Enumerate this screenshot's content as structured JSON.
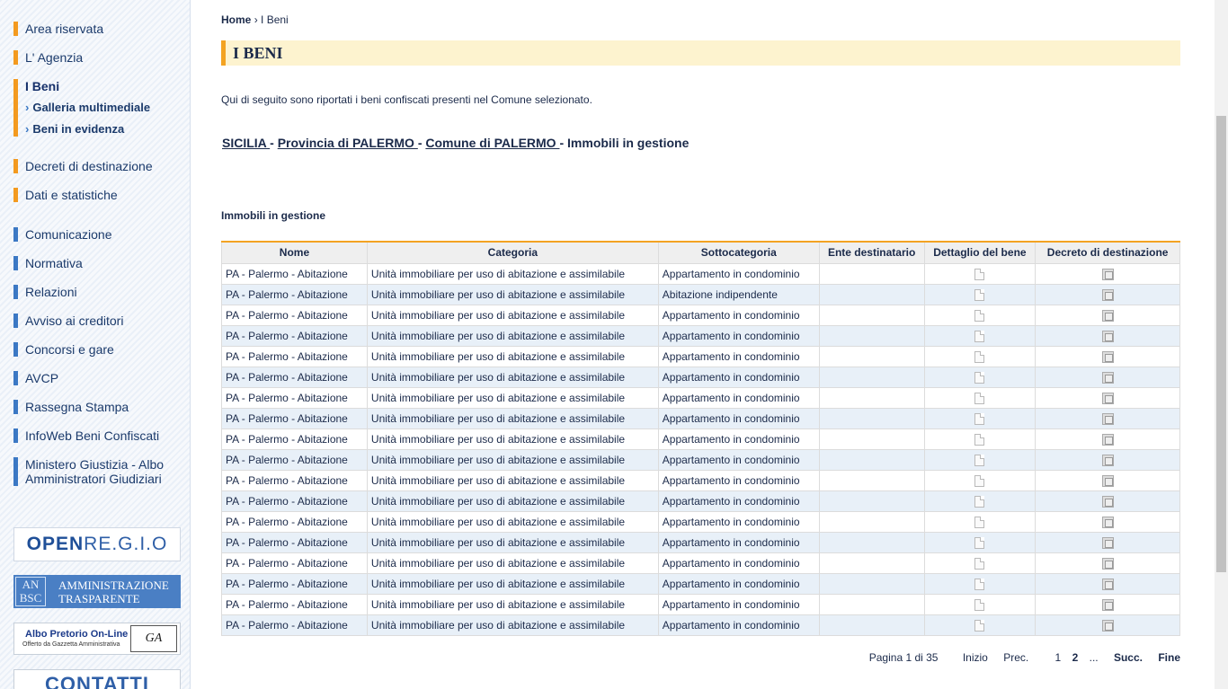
{
  "sidebar": {
    "items": [
      {
        "label": "Area riservata"
      },
      {
        "label": "L' Agenzia"
      },
      {
        "label": "I Beni",
        "subitems": [
          "Galleria multimediale",
          "Beni in evidenza"
        ]
      },
      {
        "label": "Decreti di destinazione"
      },
      {
        "label": "Dati e statistiche"
      },
      {
        "label": "Comunicazione"
      },
      {
        "label": "Normativa"
      },
      {
        "label": "Relazioni"
      },
      {
        "label": "Avviso ai creditori"
      },
      {
        "label": "Concorsi e gare"
      },
      {
        "label": "AVCP"
      },
      {
        "label": "Rassegna Stampa"
      },
      {
        "label": "InfoWeb Beni Confiscati"
      },
      {
        "label": "Ministero Giustizia - Albo Amministratori Giudiziari"
      }
    ],
    "banners": {
      "openregio_a": "OPEN",
      "openregio_b": "RE.G.I.O",
      "anbsc_logo": "AN BSC",
      "anbsc_text": "AMMINISTRAZIONE TRASPARENTE",
      "albo_title": "Albo Pretorio On-Line",
      "albo_sub": "Offerto da Gazzetta Amministrativa",
      "albo_logo": "GA",
      "contatti": "CONTATTI"
    }
  },
  "breadcrumb": {
    "home": "Home",
    "separator": "›",
    "current": "I Beni"
  },
  "page_title": "I BENI",
  "intro": "Qui di seguito sono riportati i beni confiscati presenti nel Comune selezionato.",
  "path": {
    "region": "SICILIA ",
    "province": "Provincia di PALERMO ",
    "comune": "Comune di PALERMO ",
    "sep": " - ",
    "tail": "Immobili in gestione"
  },
  "section_label": "Immobili in gestione",
  "table": {
    "headers": [
      "Nome",
      "Categoria",
      "Sottocategoria",
      "Ente destinatario",
      "Dettaglio del bene",
      "Decreto di destinazione"
    ],
    "rows": [
      [
        "PA - Palermo - Abitazione",
        "Unità immobiliare per uso di abitazione e assimilabile",
        "Appartamento in condominio",
        ""
      ],
      [
        "PA - Palermo - Abitazione",
        "Unità immobiliare per uso di abitazione e assimilabile",
        "Abitazione indipendente",
        ""
      ],
      [
        "PA - Palermo - Abitazione",
        "Unità immobiliare per uso di abitazione e assimilabile",
        "Appartamento in condominio",
        ""
      ],
      [
        "PA - Palermo - Abitazione",
        "Unità immobiliare per uso di abitazione e assimilabile",
        "Appartamento in condominio",
        ""
      ],
      [
        "PA - Palermo - Abitazione",
        "Unità immobiliare per uso di abitazione e assimilabile",
        "Appartamento in condominio",
        ""
      ],
      [
        "PA - Palermo - Abitazione",
        "Unità immobiliare per uso di abitazione e assimilabile",
        "Appartamento in condominio",
        ""
      ],
      [
        "PA - Palermo - Abitazione",
        "Unità immobiliare per uso di abitazione e assimilabile",
        "Appartamento in condominio",
        ""
      ],
      [
        "PA - Palermo - Abitazione",
        "Unità immobiliare per uso di abitazione e assimilabile",
        "Appartamento in condominio",
        ""
      ],
      [
        "PA - Palermo - Abitazione",
        "Unità immobiliare per uso di abitazione e assimilabile",
        "Appartamento in condominio",
        ""
      ],
      [
        "PA - Palermo - Abitazione",
        "Unità immobiliare per uso di abitazione e assimilabile",
        "Appartamento in condominio",
        ""
      ],
      [
        "PA - Palermo - Abitazione",
        "Unità immobiliare per uso di abitazione e assimilabile",
        "Appartamento in condominio",
        ""
      ],
      [
        "PA - Palermo - Abitazione",
        "Unità immobiliare per uso di abitazione e assimilabile",
        "Appartamento in condominio",
        ""
      ],
      [
        "PA - Palermo - Abitazione",
        "Unità immobiliare per uso di abitazione e assimilabile",
        "Appartamento in condominio",
        ""
      ],
      [
        "PA - Palermo - Abitazione",
        "Unità immobiliare per uso di abitazione e assimilabile",
        "Appartamento in condominio",
        ""
      ],
      [
        "PA - Palermo - Abitazione",
        "Unità immobiliare per uso di abitazione e assimilabile",
        "Appartamento in condominio",
        ""
      ],
      [
        "PA - Palermo - Abitazione",
        "Unità immobiliare per uso di abitazione e assimilabile",
        "Appartamento in condominio",
        ""
      ],
      [
        "PA - Palermo - Abitazione",
        "Unità immobiliare per uso di abitazione e assimilabile",
        "Appartamento in condominio",
        ""
      ],
      [
        "PA - Palermo - Abitazione",
        "Unità immobiliare per uso di abitazione e assimilabile",
        "Appartamento in condominio",
        ""
      ]
    ],
    "detail_icon": "document-icon",
    "decree_icon": "image-icon"
  },
  "pager": {
    "info": "Pagina 1 di 35",
    "first": "Inizio",
    "prev": "Prec.",
    "pages": [
      "1",
      "2"
    ],
    "ellipsis": "...",
    "next": "Succ.",
    "last": "Fine"
  },
  "colors": {
    "accent_orange": "#f3a322",
    "accent_blue": "#3b78c4",
    "title_bg": "#fdf3cf",
    "row_alt": "#e8f0f8"
  }
}
